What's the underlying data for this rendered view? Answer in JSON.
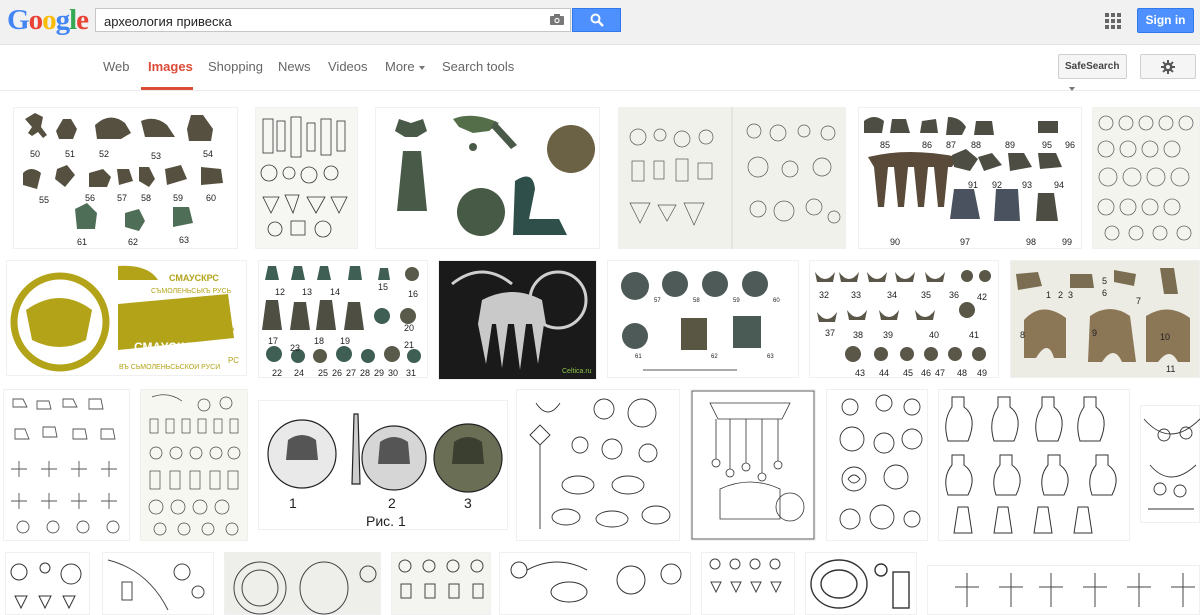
{
  "header": {
    "logo_letters": [
      {
        "ch": "G",
        "color": "#4285f4"
      },
      {
        "ch": "o",
        "color": "#ea4335"
      },
      {
        "ch": "o",
        "color": "#fbbc05"
      },
      {
        "ch": "g",
        "color": "#4285f4"
      },
      {
        "ch": "l",
        "color": "#34a853"
      },
      {
        "ch": "e",
        "color": "#ea4335"
      }
    ],
    "search_query": "археология привеска",
    "sign_in_label": "Sign in"
  },
  "nav": {
    "tabs": [
      "Web",
      "Images",
      "Shopping",
      "News",
      "Videos",
      "More",
      "Search tools"
    ],
    "active_tab": "Images",
    "safesearch_label": "SafeSearch"
  },
  "results": {
    "thumb_1_numbers": [
      "50",
      "51",
      "52",
      "53",
      "54",
      "55",
      "56",
      "57",
      "58",
      "59",
      "60",
      "61",
      "62",
      "63"
    ],
    "thumb_8_numbers": [
      "85",
      "86",
      "87",
      "88",
      "89",
      "95",
      "96",
      "91",
      "92",
      "93",
      "94",
      "90",
      "97",
      "98",
      "99"
    ],
    "thumb_10_numbers": [
      "12",
      "13",
      "14",
      "15",
      "16",
      "17",
      "18",
      "19",
      "20",
      "21",
      "22",
      "23",
      "24",
      "25",
      "26",
      "27",
      "28",
      "29",
      "30",
      "31"
    ],
    "thumb_12_numbers": [
      "57",
      "58",
      "59",
      "60",
      "61",
      "62",
      "63"
    ],
    "thumb_13_numbers": [
      "32",
      "33",
      "34",
      "35",
      "36",
      "42",
      "37",
      "38",
      "39",
      "40",
      "41",
      "43",
      "44",
      "45",
      "46",
      "47",
      "48",
      "49"
    ],
    "thumb_14_numbers": [
      "1",
      "2",
      "3",
      "5",
      "6",
      "7",
      "8",
      "9",
      "10",
      "11"
    ],
    "thumb_9_text": [
      "СМАУСКРС",
      "СЪМОЛЕНЬСЬКЪ РУСЬ",
      "ЗСТ",
      "ЖЕСТЬ",
      "СМАУСКОИРС",
      "РС",
      "ВЪ СЬМОЛЕНЬСЬСКОИ РУСИ"
    ],
    "thumb_11_site": "Celtica.ru",
    "thumb_17_labels": [
      "1",
      "2",
      "3",
      "Рис. 1"
    ]
  },
  "colors": {
    "accent_red": "#dd4b39",
    "button_blue": "#4d90fe",
    "bronze": "#5c5b4e",
    "patina": "#4f6e57",
    "gold": "#b3a319"
  }
}
